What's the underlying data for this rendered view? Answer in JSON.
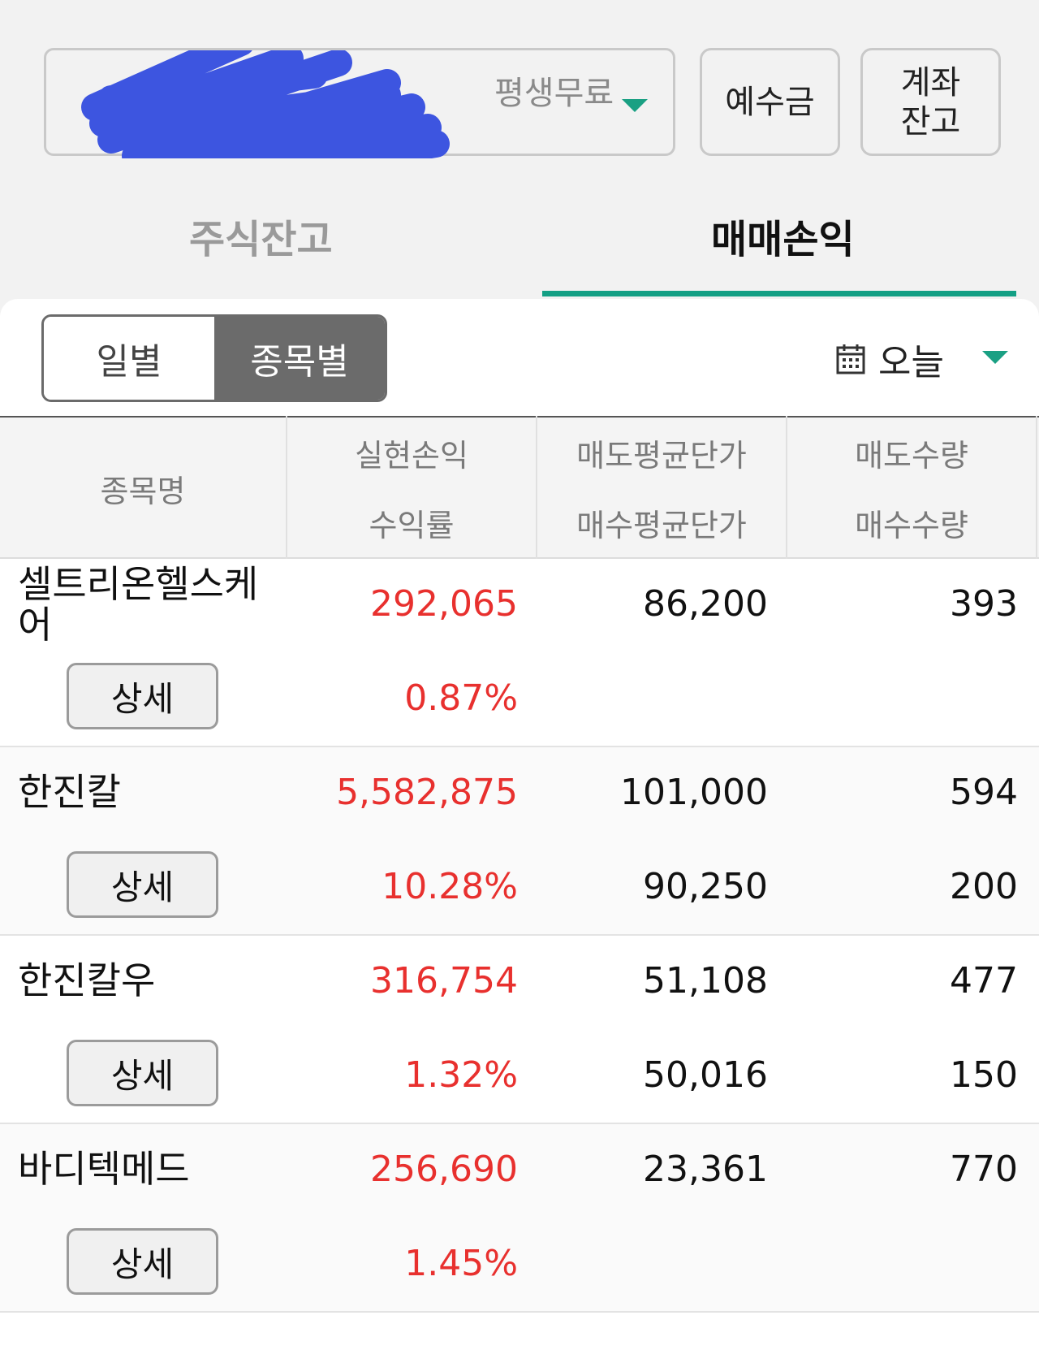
{
  "account": {
    "plan": "평생무료"
  },
  "buttons": {
    "deposit": "예수금",
    "balance": "계좌\n잔고"
  },
  "tabs": [
    {
      "label": "주식잔고"
    },
    {
      "label": "매매손익"
    }
  ],
  "segment": {
    "daily": "일별",
    "by_stock": "종목별"
  },
  "date_filter": {
    "label": "오늘",
    "icon": "calendar-icon"
  },
  "table": {
    "headers": {
      "name": "종목명",
      "realized": "실현손익",
      "return_rate": "수익률",
      "sell_avg": "매도평균단가",
      "buy_avg": "매수평균단가",
      "sell_qty": "매도수량",
      "buy_qty": "매수수량"
    },
    "detail_label": "상세",
    "rows": [
      {
        "name": "셀트리온헬스케어",
        "realized": "292,065",
        "return_rate": "0.87%",
        "sell_avg": "86,200",
        "buy_avg": "",
        "sell_qty": "393",
        "buy_qty": ""
      },
      {
        "name": "한진칼",
        "realized": "5,582,875",
        "return_rate": "10.28%",
        "sell_avg": "101,000",
        "buy_avg": "90,250",
        "sell_qty": "594",
        "buy_qty": "200"
      },
      {
        "name": "한진칼우",
        "realized": "316,754",
        "return_rate": "1.32%",
        "sell_avg": "51,108",
        "buy_avg": "50,016",
        "sell_qty": "477",
        "buy_qty": "150"
      },
      {
        "name": "바디텍메드",
        "realized": "256,690",
        "return_rate": "1.45%",
        "sell_avg": "23,361",
        "buy_avg": "",
        "sell_qty": "770",
        "buy_qty": ""
      }
    ]
  },
  "colors": {
    "accent": "#14a085",
    "profit": "#e8302e"
  }
}
